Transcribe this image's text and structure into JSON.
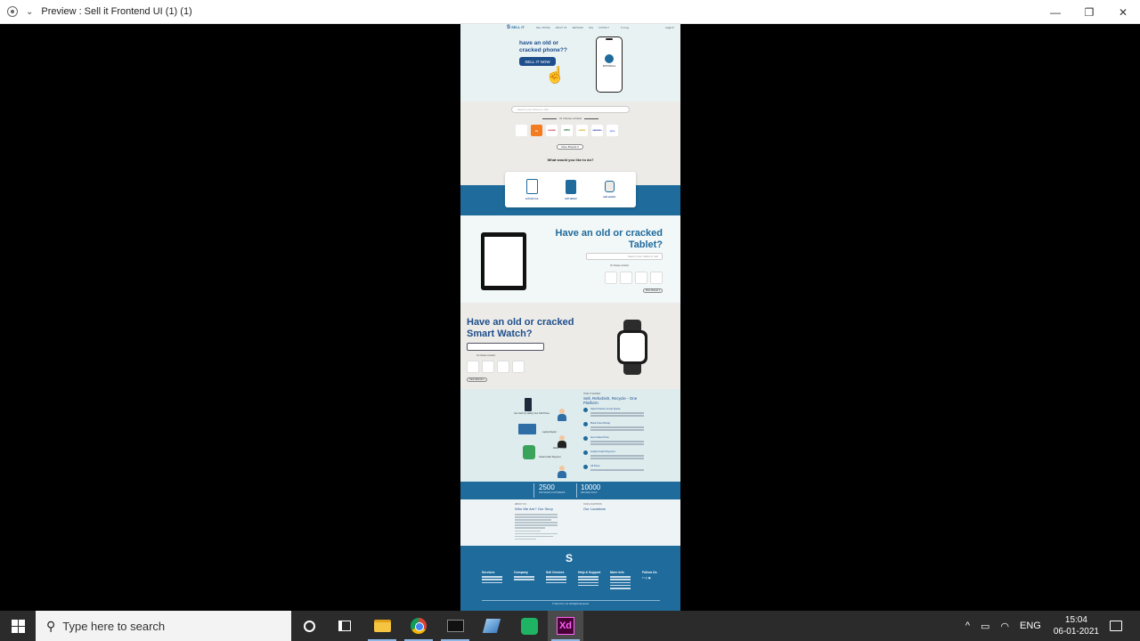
{
  "window": {
    "title": "Preview : Sell it Frontend UI (1) (1)",
    "controls": {
      "minimize": "—",
      "maximize": "❐",
      "close": "✕"
    }
  },
  "artboard": {
    "header": {
      "logo_mark": "S",
      "logo_text": "SELL IT",
      "nav": [
        "SELL PHONE",
        "ABOUT US",
        "SERVICES",
        "FAQ",
        "CONTACT"
      ],
      "icons_text": "f  t  in  ig",
      "account": "Login ▾"
    },
    "hero": {
      "question": "have an old or cracked phone??",
      "cta": "SELL IT NOW",
      "phone_brand": "MOTOROLA"
    },
    "brands_section": {
      "search_placeholder": "Search your Phone to Sell",
      "or_label": "Or choose a brand",
      "brands": [
        "",
        "mi",
        "HUAWEI",
        "OPPO",
        "realme",
        "SAMSUNG",
        "vivo"
      ],
      "more_button": "More Brands ▾",
      "question": "What would you like to do?"
    },
    "actions": [
      {
        "label": "sell phone"
      },
      {
        "label": "sell tablet"
      },
      {
        "label": "sell watch"
      }
    ],
    "tablet_section": {
      "title": "Have an old or cracked Tablet?",
      "search_placeholder": "Search your Tablet to Sell",
      "or_label": "Or choose a brand",
      "more_button": "More Brands ▾",
      "apple_glyph": ""
    },
    "watch_section": {
      "title": "Have an old or cracked Smart Watch?",
      "or_label": "Or choose a brand",
      "more_button": "More Brands ▾",
      "apple_glyph": ""
    },
    "process_section": {
      "label_phone": "Get Cash by selling Your Old Phone",
      "label_laptop": "Laptop Repair",
      "label_watch": "Watch Repair",
      "label_cash": "Instant Cash Payment",
      "why_small": "HOW IT WORKS",
      "why_title": "Sell, Refurbish, Recycle - One Platform",
      "steps": [
        "Select Device & Get Quote",
        "Book Free Pickup",
        "Get Instant Price",
        "Instant Cash Payment",
        "All Done"
      ]
    },
    "stats": [
      {
        "number": "2500",
        "label": "SATISFIED CUSTOMERS"
      },
      {
        "number": "10000",
        "label": "DEVICES SOLD"
      }
    ],
    "about": {
      "small_left": "ABOUT US",
      "title_left": "Who We Are? Our Story",
      "small_right": "OUR LOCATIONS",
      "title_right": "Our Locations"
    },
    "footer": {
      "logo": "S",
      "columns": [
        "Services",
        "Company",
        "Sell Devices",
        "Help & Support",
        "More Info",
        "Follow Us"
      ],
      "follow_icons": "f  t  ◎  ▣",
      "copyright": "© Sell It Pvt. Ltd. All Rights Reserved"
    }
  },
  "taskbar": {
    "search_placeholder": "Type here to search",
    "apps": [
      "cortana",
      "task-view",
      "file-explorer",
      "chrome",
      "terminal",
      "pencil-app",
      "chat-app",
      "adobe-xd"
    ],
    "xd_label": "Xd",
    "tray_arrow": "^",
    "language": "ENG",
    "time": "15:04",
    "date": "06-01-2021"
  }
}
